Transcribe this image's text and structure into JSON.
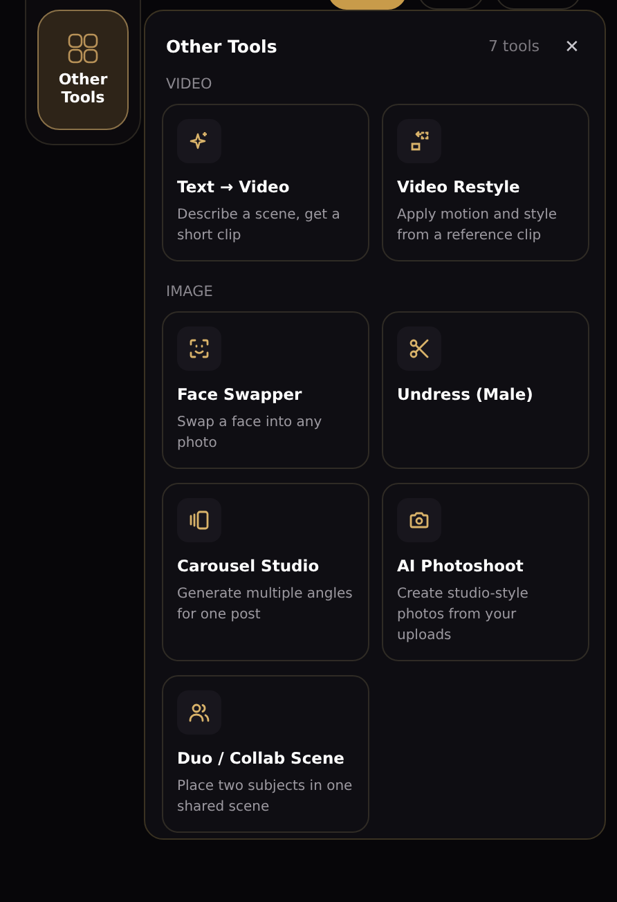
{
  "sidebar": {
    "button": {
      "label": "Other Tools",
      "selected": true
    }
  },
  "popover": {
    "title": "Other Tools",
    "count": "7 tools",
    "close": "✕",
    "sections": [
      {
        "heading": "VIDEO",
        "tools": [
          {
            "name": "Text → Video",
            "description": "Describe a scene, get a short clip"
          },
          {
            "name": "Video Restyle",
            "description": "Apply motion and style from a reference clip"
          }
        ]
      },
      {
        "heading": "IMAGE",
        "tools": [
          {
            "name": "Face Swapper",
            "description": "Swap a face into any photo"
          },
          {
            "name": "Undress (Male)"
          },
          {
            "name": "Carousel Studio",
            "description": "Generate multiple angles for one post"
          },
          {
            "name": "AI Photoshoot",
            "description": "Create studio-style photos from your uploads"
          },
          {
            "name": "Duo / Collab Scene",
            "description": "Place two subjects in one shared scene"
          }
        ]
      }
    ]
  }
}
